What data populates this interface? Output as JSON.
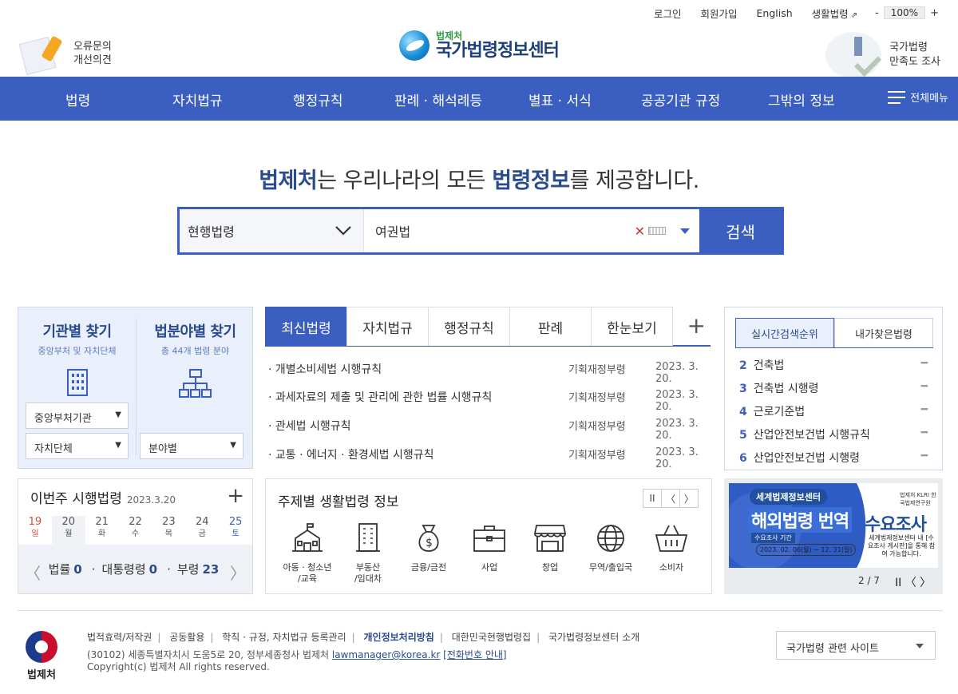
{
  "util": {
    "login": "로그인",
    "join": "회원가입",
    "english": "English",
    "life": "생활법령",
    "zoom_minus": "-",
    "zoom_value": "100%",
    "zoom_plus": "+"
  },
  "header": {
    "logo_sub": "법제처",
    "logo_main": "국가법령정보센터",
    "err_line1": "오류문의",
    "err_line2": "개선의견",
    "survey_line1": "국가법령",
    "survey_line2": "만족도 조사"
  },
  "nav": {
    "items": [
      "법령",
      "자치법규",
      "행정규칙",
      "판례 · 해석례등",
      "별표 · 서식",
      "공공기관 규정",
      "그밖의 정보"
    ],
    "all_menu": "전체메뉴"
  },
  "hero": {
    "tag_a": "법제처",
    "tag_b": "는 우리나라의 모든 ",
    "tag_c": "법령정보",
    "tag_d": "를 제공합니다.",
    "select_value": "현행법령",
    "search_value": "여권법",
    "search_button": "검색"
  },
  "finder": {
    "org_title": "기관별 찾기",
    "org_sub": "중앙부처 및 자치단체",
    "field_title": "법분야별 찾기",
    "field_sub": "총 44개 법령 분야",
    "sel_central": "중앙부처기관",
    "sel_local": "자치단체",
    "sel_field": "분야별"
  },
  "latest": {
    "tabs": [
      "최신법령",
      "자치법규",
      "행정규칙",
      "판례",
      "한눈보기"
    ],
    "plus": "+",
    "rows": [
      {
        "title": "· 개별소비세법 시행규칙",
        "org": "기획재정부령",
        "date": "2023. 3. 20."
      },
      {
        "title": "· 과세자료의 제출 및 관리에 관한 법률 시행규칙",
        "org": "기획재정부령",
        "date": "2023. 3. 20."
      },
      {
        "title": "· 관세법 시행규칙",
        "org": "기획재정부령",
        "date": "2023. 3. 20."
      },
      {
        "title": "· 교통 · 에너지 · 환경세법 시행규칙",
        "org": "기획재정부령",
        "date": "2023. 3. 20."
      }
    ]
  },
  "rank": {
    "tab_live": "실시간검색순위",
    "tab_mine": "내가찾은법령",
    "items": [
      {
        "n": "2",
        "name": "건축법",
        "d": "━"
      },
      {
        "n": "3",
        "name": "건축법 시행령",
        "d": "━"
      },
      {
        "n": "4",
        "name": "근로기준법",
        "d": "━"
      },
      {
        "n": "5",
        "name": "산업안전보건법 시행규칙",
        "d": "━"
      },
      {
        "n": "6",
        "name": "산업안전보건법 시행령",
        "d": "━"
      }
    ]
  },
  "week": {
    "title": "이번주 시행법령",
    "date": "2023.3.20",
    "plus": "+",
    "days": [
      {
        "d": "19",
        "w": "일"
      },
      {
        "d": "20",
        "w": "월"
      },
      {
        "d": "21",
        "w": "화"
      },
      {
        "d": "22",
        "w": "수"
      },
      {
        "d": "23",
        "w": "목"
      },
      {
        "d": "24",
        "w": "금"
      },
      {
        "d": "25",
        "w": "토"
      }
    ],
    "law_label": "법률",
    "law_n": "0",
    "pres_label": "대통령령",
    "pres_n": "0",
    "min_label": "부령",
    "min_n": "23",
    "dot": "·",
    "prev": "〈",
    "next": "〉"
  },
  "topics": {
    "title": "주제별 생활법령 정보",
    "pause": "II",
    "prev": "〈",
    "next": "〉",
    "items": [
      {
        "l1": "아동 · 청소년",
        "l2": "/교육",
        "icon": "school-icon"
      },
      {
        "l1": "부동산",
        "l2": "/임대차",
        "icon": "building-icon"
      },
      {
        "l1": "금융/금전",
        "l2": "",
        "icon": "money-bag-icon"
      },
      {
        "l1": "사업",
        "l2": "",
        "icon": "briefcase-icon"
      },
      {
        "l1": "창업",
        "l2": "",
        "icon": "store-icon"
      },
      {
        "l1": "무역/출입국",
        "l2": "",
        "icon": "globe-icon"
      },
      {
        "l1": "소비자",
        "l2": "",
        "icon": "basket-icon"
      }
    ]
  },
  "banner": {
    "top": "세계법제정보센터",
    "big": "해외법령 번역",
    "period_label": "수요조사 기간",
    "period": "2023. 02. 06(월) ~ 12. 31(일)",
    "right_big": "수요조사",
    "right_small": "세계법제정보센터 내 [수요조사 게시판]을 통해 참여 가능합니다.",
    "brand": "법제처 KLRI 한국법제연구원",
    "page": "2 / 7",
    "pause": "II",
    "prev": "〈",
    "next": "〉"
  },
  "footer": {
    "logo": "법제처",
    "links": [
      "법적효력/저작권",
      "공동활용",
      "학칙 · 규정, 자치법규 등록관리",
      "개인정보처리방침",
      "대한민국현행법령집",
      "국가법령정보센터 소개"
    ],
    "sep": "|",
    "address": "(30102) 세종특별자치시 도움5로 20, 정부세종청사 법제처",
    "email": "lawmanager@korea.kr",
    "phone": "[전화번호 안내]",
    "copyright": "Copyright(c) 법제처 All rights reserved.",
    "site_select": "국가법령 관련 사이트"
  },
  "colors": {
    "brand_blue": "#3b5fc0",
    "navy": "#2a4b8d",
    "light_bg": "#eaf0fb",
    "sunday_red": "#e0453a"
  }
}
